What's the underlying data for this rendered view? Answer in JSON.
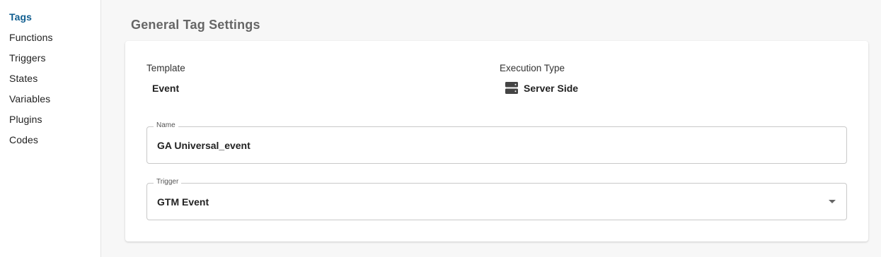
{
  "sidebar": {
    "items": [
      {
        "label": "Tags",
        "active": true
      },
      {
        "label": "Functions"
      },
      {
        "label": "Triggers"
      },
      {
        "label": "States"
      },
      {
        "label": "Variables"
      },
      {
        "label": "Plugins"
      },
      {
        "label": "Codes"
      }
    ]
  },
  "section": {
    "title": "General Tag Settings"
  },
  "form": {
    "template": {
      "label": "Template",
      "value": "Event"
    },
    "execution_type": {
      "label": "Execution Type",
      "value": "Server Side",
      "icon": "server-icon"
    },
    "name": {
      "label": "Name",
      "value": "GA Universal_event"
    },
    "trigger": {
      "label": "Trigger",
      "value": "GTM Event",
      "icon": "chevron-down-icon"
    }
  },
  "colors": {
    "accent": "#0f5d8f",
    "background": "#f7f7f7",
    "card": "#ffffff",
    "border": "#c9c9c9"
  }
}
